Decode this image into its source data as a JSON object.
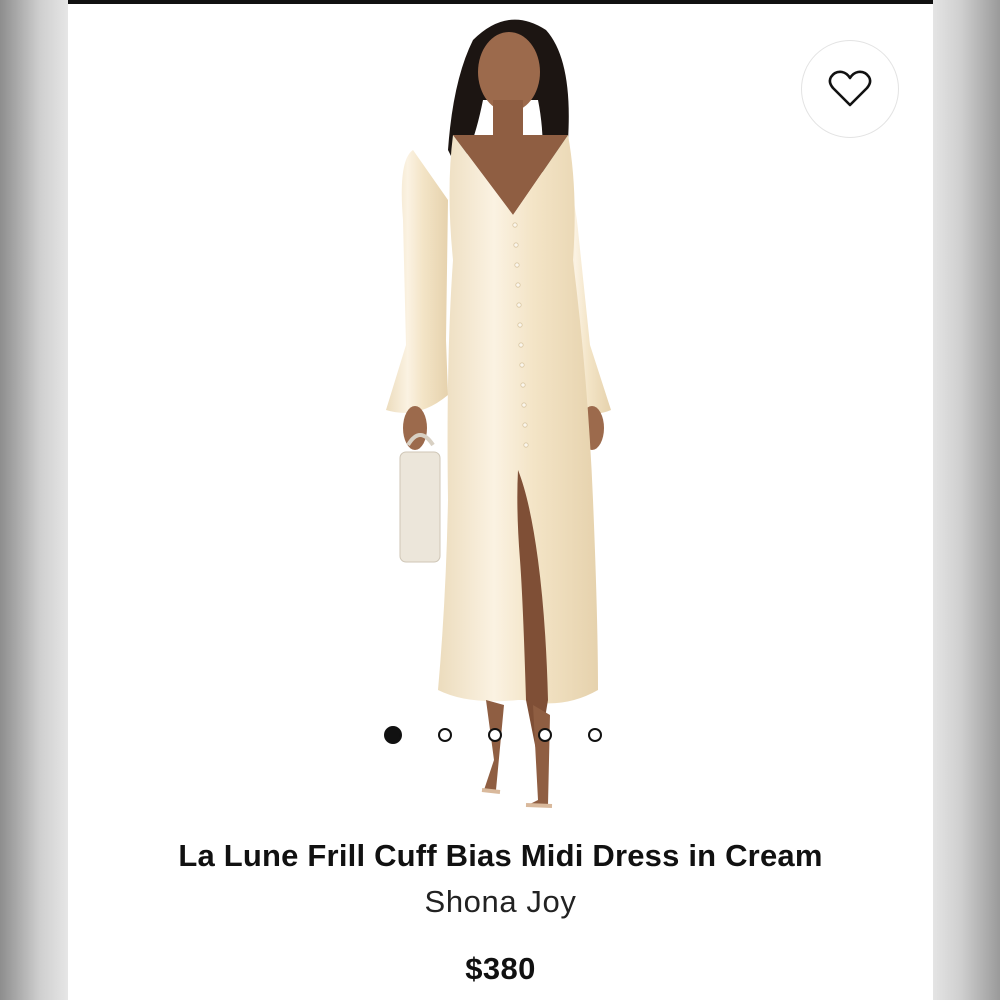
{
  "product": {
    "title": "La Lune Frill Cuff Bias Midi Dress in Cream",
    "brand": "Shona Joy",
    "price": "$380"
  },
  "gallery": {
    "image_count": 5,
    "active_index": 0
  },
  "wishlist": {
    "icon": "heart-icon"
  },
  "colors": {
    "accent": "#111111",
    "dress": "#f5e8cf"
  }
}
